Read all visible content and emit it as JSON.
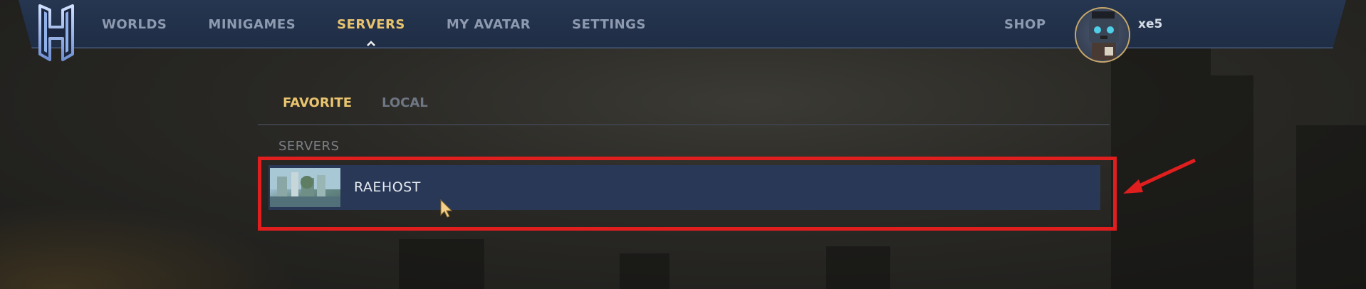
{
  "nav": {
    "items": [
      "WORLDS",
      "MINIGAMES",
      "SERVERS",
      "MY AVATAR",
      "SETTINGS"
    ],
    "active": "SERVERS",
    "shop_label": "SHOP",
    "username": "xe5"
  },
  "tabs": {
    "favorite_label": "FAVORITE",
    "local_label": "LOCAL",
    "active": "FAVORITE"
  },
  "section": {
    "label": "SERVERS"
  },
  "servers": [
    {
      "name": "RAEHOST"
    }
  ],
  "colors": {
    "accent_gold": "#e9c46f",
    "nav_bg": "#263650",
    "row_bg": "#283856",
    "annotation_red": "#e01e1e"
  },
  "icons": {
    "logo": "hytale-h-logo",
    "nav_caret": "chevron-up-icon",
    "cursor": "mouse-cursor-icon",
    "annotation": "red-arrow-icon"
  }
}
